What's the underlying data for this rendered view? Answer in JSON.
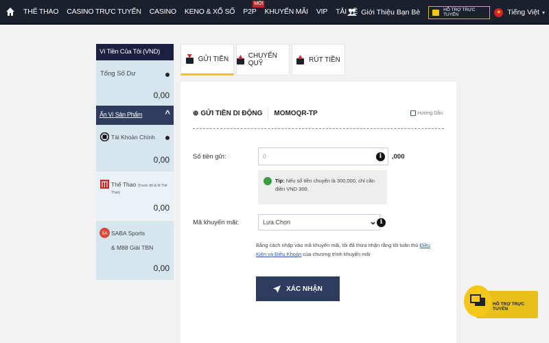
{
  "nav": {
    "items": [
      {
        "label": "THỂ THAO"
      },
      {
        "label": "CASINO TRỰC TUYẾN"
      },
      {
        "label": "CASINO"
      },
      {
        "label": "KENO & XỔ SỐ"
      },
      {
        "label": "P2P",
        "badge": "MỚI"
      },
      {
        "label": "KHUYẾN MÃI"
      },
      {
        "label": "VIP"
      },
      {
        "label": "TẢI VỀ"
      }
    ],
    "refer_label": "Giới Thiệu Bạn Bè",
    "support_label": "HỖ TRỢ TRỰC TUYẾN",
    "language_label": "Tiếng Việt"
  },
  "wallet": {
    "title": "Ví Tiền Của Tôi (VND)",
    "total_label": "Tổng Số Dư",
    "total_value": "0,00",
    "hide_label": "Ẩn Ví Sản Phẩm",
    "products": [
      {
        "name": "Tài Khoản Chính",
        "value": "0,00",
        "icon": "wallet-icon"
      },
      {
        "name": "Thể Thao",
        "note": "(Trước đó là M Thể Thao)",
        "value": "0,00",
        "icon": "sports-icon"
      },
      {
        "name": "SABA Sports",
        "name_line2": "& M88 Giải TBN",
        "value": "0,00",
        "icon": "saba-icon"
      }
    ]
  },
  "tabs": [
    {
      "label": "GỬI TIỀN",
      "active": true
    },
    {
      "label": "CHUYỂN QUỸ",
      "active": false
    },
    {
      "label": "RÚT TIỀN",
      "active": false
    }
  ],
  "form": {
    "method_label": "GỬI TIỀN DI ĐỘNG",
    "method_code": "MOMOQR-TP",
    "guide_label": "Hướng Dẫn",
    "amount_label": "Số tiền gửi:",
    "amount_placeholder": "0",
    "amount_suffix": ",000",
    "tip_bold": "Tip:",
    "tip_text": " Nếu số tiền chuyển là 300,000, chỉ cần điền VND 300.",
    "promo_label": "Mã khuyến mãi:",
    "promo_value": "Lựa Chọn",
    "terms_text": "Bằng cách nhập vào mã khuyến mãi, tôi đã thừa nhận rằng tôi tuân thủ ",
    "terms_link": "Điều Kiện và Điều Khoản",
    "terms_after": " của chương trình khuyến mãi",
    "submit_label": "XÁC NHẬN"
  },
  "float_support": {
    "label": "HỖ TRỢ TRỰC TUYẾN"
  },
  "colors": {
    "nav_bg": "#1a202c",
    "accent": "#f0c419",
    "button": "#2d3c5e",
    "wallet_head": "#1b1f40"
  }
}
